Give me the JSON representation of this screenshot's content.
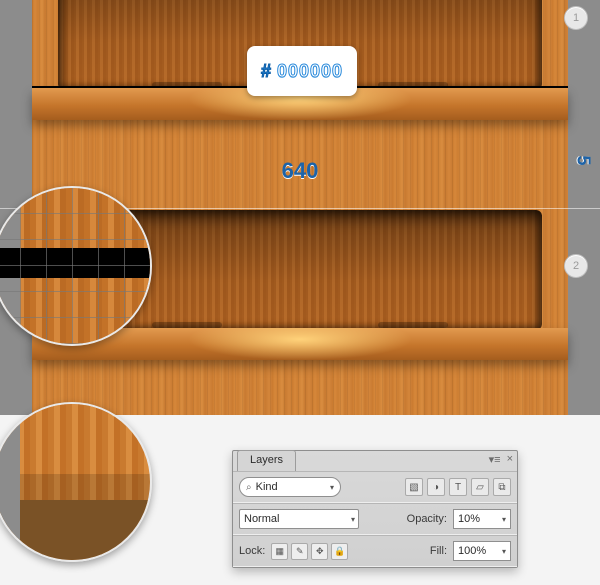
{
  "color_swatch": {
    "hash": "#",
    "hex": "000000"
  },
  "canvas": {
    "width_label": "640",
    "height_label": "5"
  },
  "steps": {
    "one": "1",
    "two": "2"
  },
  "layers_panel": {
    "title": "Layers",
    "flyout_glyph": "▾≡",
    "close_glyph": "×",
    "search_icon": "⌕",
    "filter_label": "Kind",
    "filter_icons": {
      "image": "▧",
      "adjust": "◑",
      "type": "T",
      "shape": "▱",
      "smart": "⧉"
    },
    "blend_mode": "Normal",
    "opacity_label": "Opacity:",
    "opacity_value": "10%",
    "lock_label": "Lock:",
    "lock_icons": {
      "transparent": "▦",
      "paint": "✎",
      "move": "✥",
      "all": "🔒"
    },
    "fill_label": "Fill:",
    "fill_value": "100%"
  }
}
